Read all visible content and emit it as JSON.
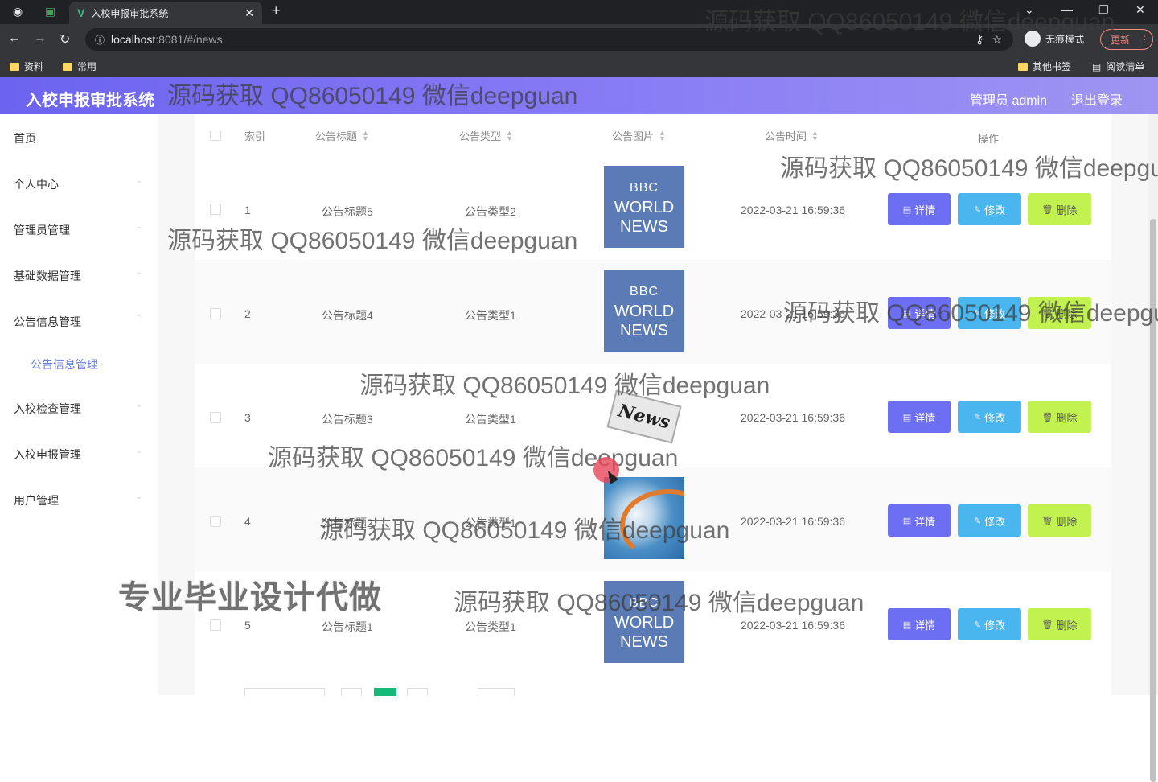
{
  "browser": {
    "tab_title": "入校申报审批系统",
    "new_tab": "+",
    "close_tab": "✕",
    "url_host": "localhost",
    "url_path": ":8081/#/news",
    "incognito_label": "无痕模式",
    "update_label": "更新",
    "bookmarks": [
      "资料",
      "常用"
    ],
    "other_bookmarks": "其他书签",
    "reading_list": "阅读清单"
  },
  "header": {
    "title": "入校申报审批系统",
    "admin": "管理员 admin",
    "logout": "退出登录"
  },
  "sidebar": {
    "items": [
      {
        "label": "首页"
      },
      {
        "label": "个人中心"
      },
      {
        "label": "管理员管理"
      },
      {
        "label": "基础数据管理"
      },
      {
        "label": "公告信息管理"
      },
      {
        "label": "入校检查管理"
      },
      {
        "label": "入校申报管理"
      },
      {
        "label": "用户管理"
      }
    ],
    "sub_active": "公告信息管理"
  },
  "table": {
    "columns": {
      "index": "索引",
      "title": "公告标题",
      "type": "公告类型",
      "image": "公告图片",
      "time": "公告时间",
      "actions": "操作"
    },
    "rows": [
      {
        "index": "1",
        "title": "公告标题5",
        "type": "公告类型2",
        "image": "bbc",
        "time": "2022-03-21 16:59:36"
      },
      {
        "index": "2",
        "title": "公告标题4",
        "type": "公告类型1",
        "image": "bbc",
        "time": "2022-03-21 16:59:36"
      },
      {
        "index": "3",
        "title": "公告标题3",
        "type": "公告类型1",
        "image": "paper",
        "time": "2022-03-21 16:59:36"
      },
      {
        "index": "4",
        "title": "公告标题2",
        "type": "公告类型1",
        "image": "globe",
        "time": "2022-03-21 16:59:36"
      },
      {
        "index": "5",
        "title": "公告标题1",
        "type": "公告类型1",
        "image": "bbc",
        "time": "2022-03-21 16:59:36"
      }
    ],
    "btn_detail": "详情",
    "btn_edit": "修改",
    "btn_delete": "删除"
  },
  "bbc_text": {
    "l1": "BBC",
    "l2": "WORLD",
    "l3": "NEWS"
  },
  "news_text": "News",
  "watermarks": {
    "source": "源码获取 QQ86050149 微信deepguan",
    "service": "专业毕业设计代做"
  }
}
